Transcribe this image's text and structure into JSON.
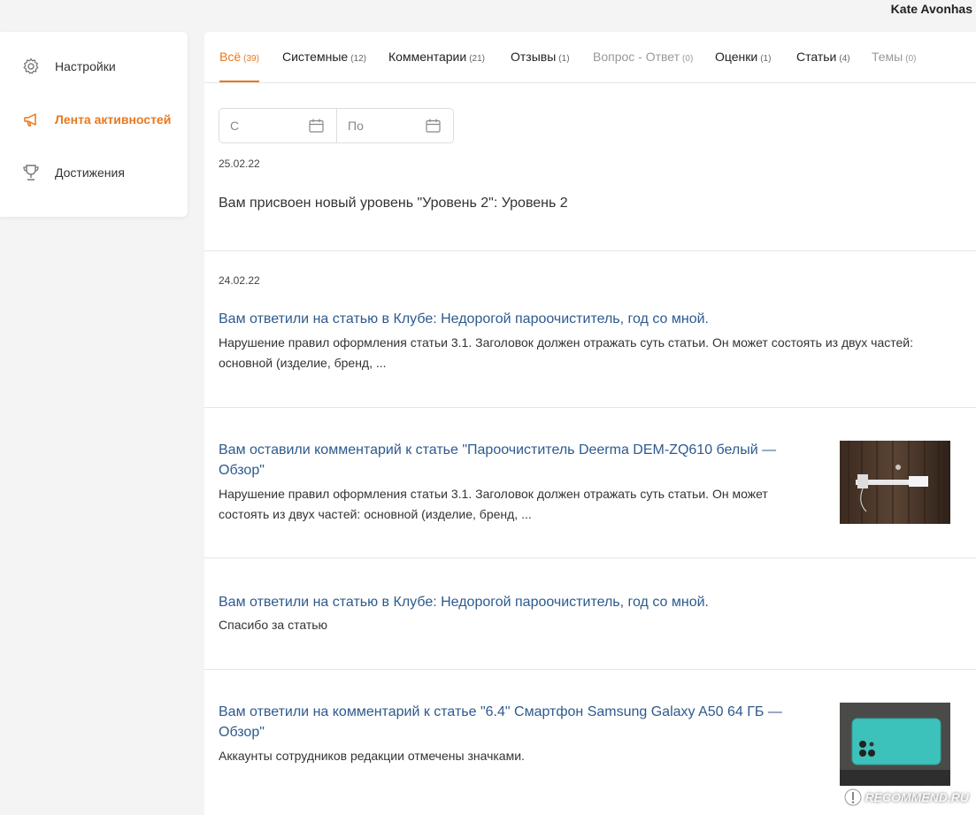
{
  "header": {
    "username": "Kate Avonhas"
  },
  "sidebar": {
    "items": [
      {
        "label": "Настройки",
        "icon": "gear-icon"
      },
      {
        "label": "Лента активностей",
        "icon": "megaphone-icon",
        "active": true
      },
      {
        "label": "Достижения",
        "icon": "trophy-icon"
      }
    ]
  },
  "tabs": [
    {
      "label": "Всё",
      "count": "(39)"
    },
    {
      "label": "Системные",
      "count": "(12)"
    },
    {
      "label": "Комментарии",
      "count": "(21)"
    },
    {
      "label": "Отзывы",
      "count": "(1)"
    },
    {
      "label": "Вопрос - Ответ",
      "count": "(0)"
    },
    {
      "label": "Оценки",
      "count": "(1)"
    },
    {
      "label": "Статьи",
      "count": "(4)"
    },
    {
      "label": "Темы",
      "count": "(0)"
    }
  ],
  "filters": {
    "from_placeholder": "С",
    "to_placeholder": "По"
  },
  "feed": {
    "date1": "25.02.22",
    "item1_text": "Вам присвоен новый уровень \"Уровень 2\": Уровень 2",
    "date2": "24.02.22",
    "item2_title": "Вам ответили на статью в Клубе: Недорогой пароочиститель, год со мной.",
    "item2_desc_l1": "Нарушение правил оформления статьи 3.1. Заголовок должен отражать суть статьи. Он может состоять из двух частей:",
    "item2_desc_l2": "основной (изделие, бренд, ...",
    "item3_title_l1": "Вам оставили комментарий к статье \"Пароочиститель Deerma DEM-ZQ610 белый —",
    "item3_title_l2": "Обзор\"",
    "item3_desc_l1": "Нарушение правил оформления статьи 3.1. Заголовок должен отражать суть статьи. Он может",
    "item3_desc_l2": "состоять из двух частей: основной (изделие, бренд, ...",
    "item4_title": "Вам ответили на статью в Клубе: Недорогой пароочиститель, год со мной.",
    "item4_desc": "Спасибо за статью",
    "item5_title_l1": "Вам ответили на комментарий к статье \"6.4\" Смартфон Samsung Galaxy A50 64 ГБ —",
    "item5_title_l2": "Обзор\"",
    "item5_desc": "Аккаунты сотрудников редакции отмечены значками."
  },
  "watermark": "RECOMMEND.RU",
  "colors": {
    "accent": "#e8781e",
    "link": "#2d5a8e"
  }
}
